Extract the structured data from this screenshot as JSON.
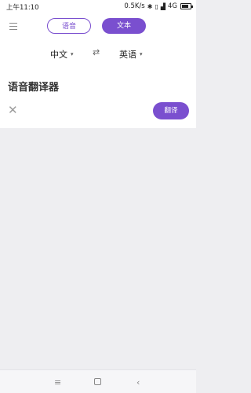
{
  "status_bar": {
    "time": "上午11:10",
    "network_speed": "0.5K/s",
    "network": "4G",
    "icons": [
      "bluetooth-icon",
      "vibrate-icon",
      "signal-icon",
      "battery-icon"
    ]
  },
  "header": {
    "mode_voice_label": "语音",
    "mode_text_label": "文本",
    "active_mode": "文本"
  },
  "languages": {
    "source": "中文",
    "target": "英语",
    "swap_symbol": "⇄"
  },
  "main": {
    "title": "语音翻译器",
    "translate_label": "翻译"
  },
  "colors": {
    "accent": "#7a4fcf",
    "background": "#eeeef1"
  }
}
